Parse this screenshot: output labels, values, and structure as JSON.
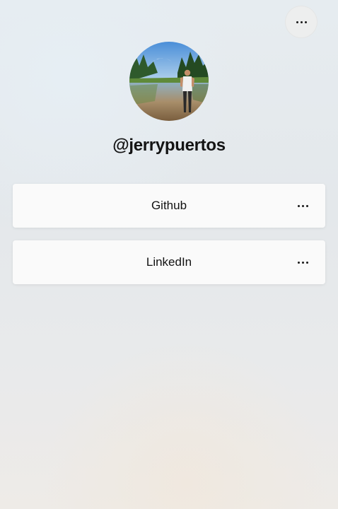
{
  "profile": {
    "username": "@jerrypuertos",
    "avatar_icon": "profile-photo"
  },
  "header": {
    "menu_icon": "more-horizontal-icon"
  },
  "links": [
    {
      "label": "Github",
      "menu_icon": "more-horizontal-icon"
    },
    {
      "label": "LinkedIn",
      "menu_icon": "more-horizontal-icon"
    }
  ],
  "colors": {
    "text": "#141414",
    "card_background": "#fafafa",
    "page_background": "#e6ebee"
  }
}
